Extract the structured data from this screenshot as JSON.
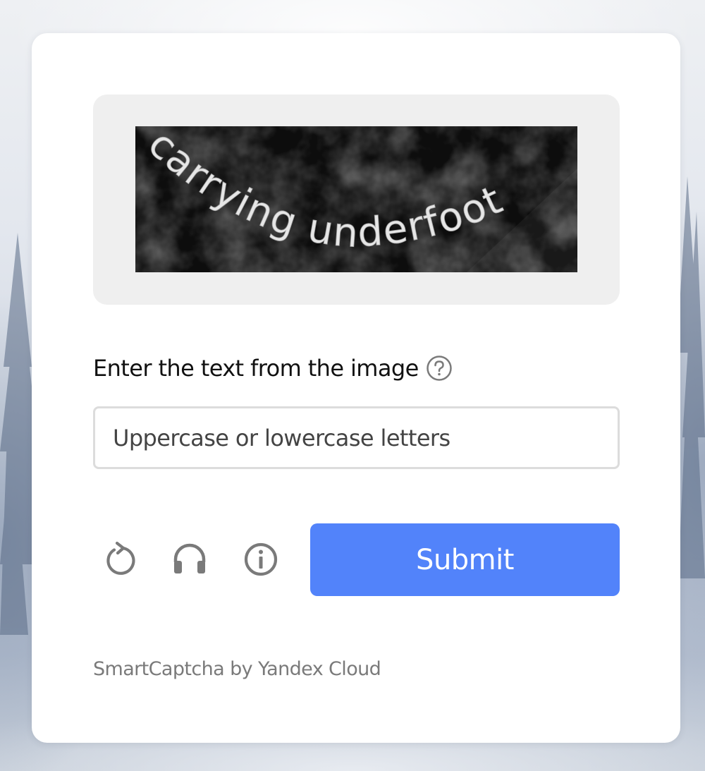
{
  "captcha": {
    "image_text": "carrying underfoot",
    "prompt_label": "Enter the text from the image",
    "help_icon": "question-circle-icon",
    "input": {
      "value": "",
      "placeholder": "Uppercase or lowercase letters"
    },
    "toolbar": [
      {
        "name": "refresh-button",
        "icon": "refresh-icon"
      },
      {
        "name": "audio-button",
        "icon": "headphones-icon"
      },
      {
        "name": "info-button",
        "icon": "info-icon"
      }
    ],
    "submit_label": "Submit",
    "footer": "SmartCaptcha by Yandex Cloud"
  },
  "colors": {
    "accent": "#5283fa",
    "card": "#ffffff",
    "image_frame": "#efefef",
    "icon": "#7a7a7a"
  }
}
